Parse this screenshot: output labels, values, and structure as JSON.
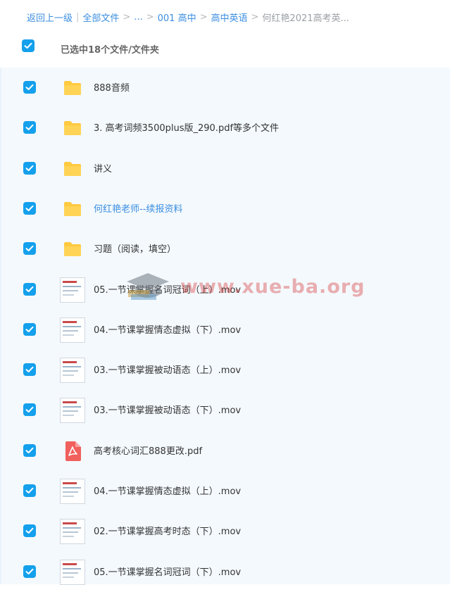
{
  "breadcrumb": {
    "back": "返回上一级",
    "all_files": "全部文件",
    "ellipsis": "...",
    "level1": "001 高中",
    "level2": "高中英语",
    "current": "何红艳2021高考英..."
  },
  "selection": {
    "summary": "已选中18个文件/文件夹",
    "all_checked": true
  },
  "files": [
    {
      "name": "888音频",
      "icon": "folder-icon",
      "link": false
    },
    {
      "name": "3. 高考词频3500plus版_290.pdf等多个文件",
      "icon": "folder-icon",
      "link": false
    },
    {
      "name": "讲义",
      "icon": "folder-icon",
      "link": false
    },
    {
      "name": "何红艳老师--续报资料",
      "icon": "folder-icon",
      "link": true
    },
    {
      "name": "习题（阅读，填空）",
      "icon": "folder-icon",
      "link": false
    },
    {
      "name": "05.一节课掌握名词冠词（上）.mov",
      "icon": "video-thumbnail-icon",
      "link": false
    },
    {
      "name": "04.一节课掌握情态虚拟（下）.mov",
      "icon": "video-thumbnail-icon",
      "link": false
    },
    {
      "name": "03.一节课掌握被动语态（上）.mov",
      "icon": "video-thumbnail-icon",
      "link": false
    },
    {
      "name": "03.一节课掌握被动语态（下）.mov",
      "icon": "video-thumbnail-icon",
      "link": false
    },
    {
      "name": "高考核心词汇888更改.pdf",
      "icon": "pdf-icon",
      "link": false
    },
    {
      "name": "04.一节课掌握情态虚拟（上）.mov",
      "icon": "video-thumbnail-icon",
      "link": false
    },
    {
      "name": "02.一节课掌握高考时态（下）.mov",
      "icon": "video-thumbnail-icon",
      "link": false
    },
    {
      "name": "05.一节课掌握名词冠词（下）.mov",
      "icon": "video-thumbnail-icon",
      "link": false
    }
  ],
  "watermark": {
    "text": "www.xue-ba.org",
    "icon": "graduation-cap-icon"
  },
  "colors": {
    "accent": "#14a0ec",
    "link": "#3b8ee0",
    "folder": "#ffc940",
    "pdf": "#f0605d",
    "list_bg": "#f4f9fd"
  }
}
